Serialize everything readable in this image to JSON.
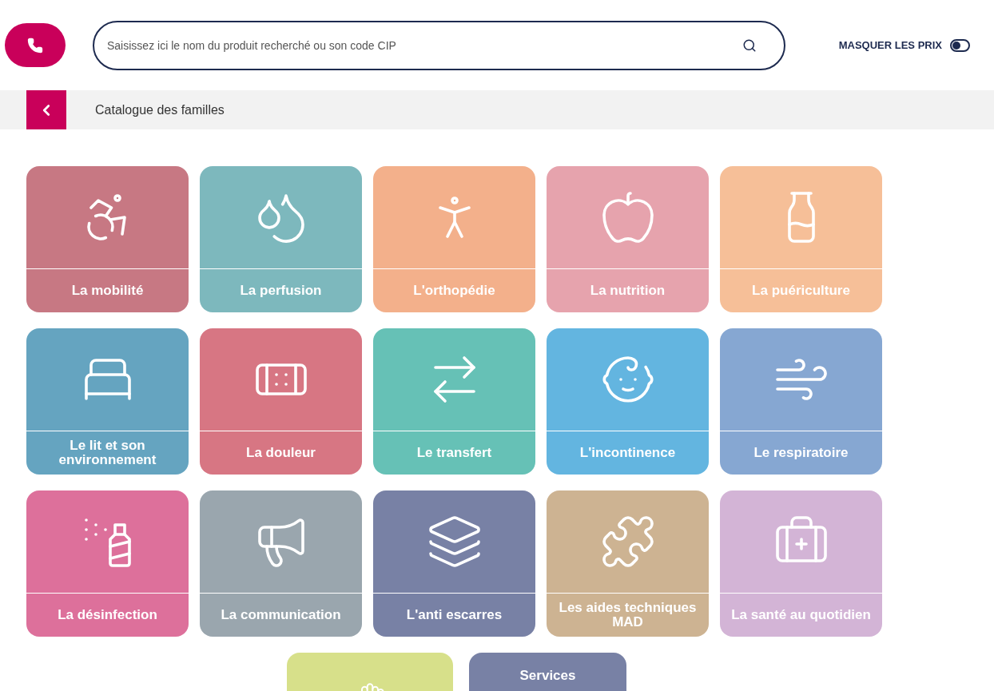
{
  "search": {
    "placeholder": "Saisissez ici le nom du produit recherché ou son code CIP"
  },
  "price_toggle": {
    "label": "MASQUER LES PRIX",
    "on": false
  },
  "breadcrumb": {
    "title": "Catalogue des familles"
  },
  "categories": [
    {
      "label": "La mobilité",
      "color": "#c77883"
    },
    {
      "label": "La perfusion",
      "color": "#7db8bd"
    },
    {
      "label": "L'orthopédie",
      "color": "#f3b08b"
    },
    {
      "label": "La nutrition",
      "color": "#e6a3ad"
    },
    {
      "label": "La puériculture",
      "color": "#f6bf98"
    },
    {
      "label": "Le lit et son environnement",
      "color": "#65a4c0"
    },
    {
      "label": "La douleur",
      "color": "#d77683"
    },
    {
      "label": "Le transfert",
      "color": "#66c1b6"
    },
    {
      "label": "L'incontinence",
      "color": "#63b5e0"
    },
    {
      "label": "Le respiratoire",
      "color": "#86a7d2"
    },
    {
      "label": "La désinfection",
      "color": "#dd709b"
    },
    {
      "label": "La communication",
      "color": "#9aa6ae"
    },
    {
      "label": "L'anti escarres",
      "color": "#7881a5"
    },
    {
      "label": "Les aides techniques MAD",
      "color": "#cdb392"
    },
    {
      "label": "La santé au quotidien",
      "color": "#d3b4d6"
    }
  ],
  "partial_categories": [
    {
      "color": "#d7e08a"
    },
    {
      "label": "Services",
      "color": "#7881a5"
    }
  ]
}
